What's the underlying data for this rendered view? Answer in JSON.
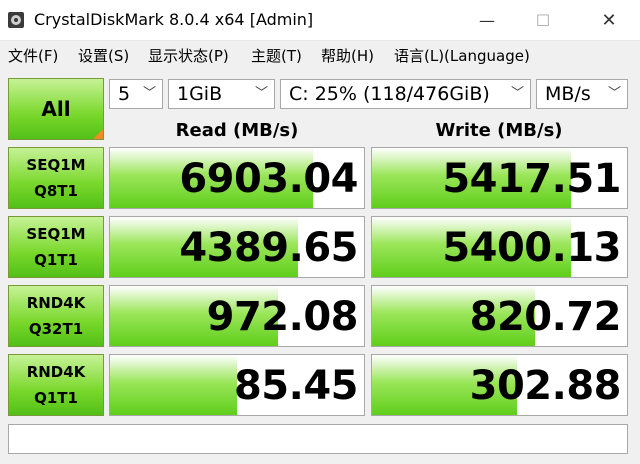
{
  "window": {
    "title": "CrystalDiskMark 8.0.4 x64 [Admin]",
    "minimize": "—",
    "maximize": "☐",
    "close": "✕"
  },
  "menu": [
    "文件(F)",
    "设置(S)",
    "显示状态(P)",
    "主题(T)",
    "帮助(H)",
    "语言(L)(Language)"
  ],
  "controls": {
    "all_label": "All",
    "count": "5",
    "size": "1GiB",
    "drive": "C: 25% (118/476GiB)",
    "unit": "MB/s"
  },
  "headers": {
    "read": "Read (MB/s)",
    "write": "Write (MB/s)"
  },
  "tests": [
    {
      "line1": "SEQ1M",
      "line2": "Q8T1",
      "read": "6903.04",
      "write": "5417.51",
      "read_fill": 0.8,
      "write_fill": 0.78
    },
    {
      "line1": "SEQ1M",
      "line2": "Q1T1",
      "read": "4389.65",
      "write": "5400.13",
      "read_fill": 0.74,
      "write_fill": 0.78
    },
    {
      "line1": "RND4K",
      "line2": "Q32T1",
      "read": "972.08",
      "write": "820.72",
      "read_fill": 0.66,
      "write_fill": 0.64
    },
    {
      "line1": "RND4K",
      "line2": "Q1T1",
      "read": "85.45",
      "write": "302.88",
      "read_fill": 0.5,
      "write_fill": 0.57
    }
  ],
  "colors": {
    "green_light": "#c6f296",
    "green_dark": "#52c018",
    "corner_orange": "#f28b22"
  },
  "comment": ""
}
